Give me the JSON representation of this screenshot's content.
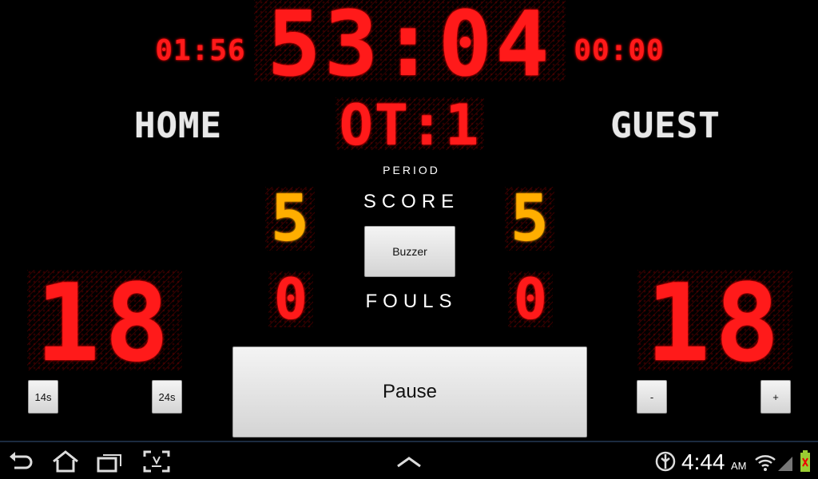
{
  "scoreboard": {
    "game_clock": "53:04",
    "left_clock": "01:56",
    "right_clock": "00:00",
    "period_value": "OT:1",
    "period_label": "PERIOD",
    "home_label": "HOME",
    "guest_label": "GUEST",
    "score_label": "SCORE",
    "fouls_label": "FOULS",
    "home_score": "5",
    "guest_score": "5",
    "home_fouls": "0",
    "guest_fouls": "0",
    "home_shot_clock": "18",
    "guest_shot_clock": "18"
  },
  "buttons": {
    "buzzer": "Buzzer",
    "pause": "Pause",
    "shot_14": "14s",
    "shot_24": "24s",
    "minus": "-",
    "plus": "+"
  },
  "status_bar": {
    "time": "4:44",
    "ampm": "AM"
  },
  "colors": {
    "led_red": "#ff1a1a",
    "led_orange": "#ffae00",
    "background": "#000000"
  },
  "icons": [
    "back-icon",
    "home-icon",
    "recent-apps-icon",
    "screenshot-icon",
    "up-chevron-icon",
    "usb-debug-icon",
    "wifi-icon",
    "signal-icon",
    "battery-icon"
  ]
}
